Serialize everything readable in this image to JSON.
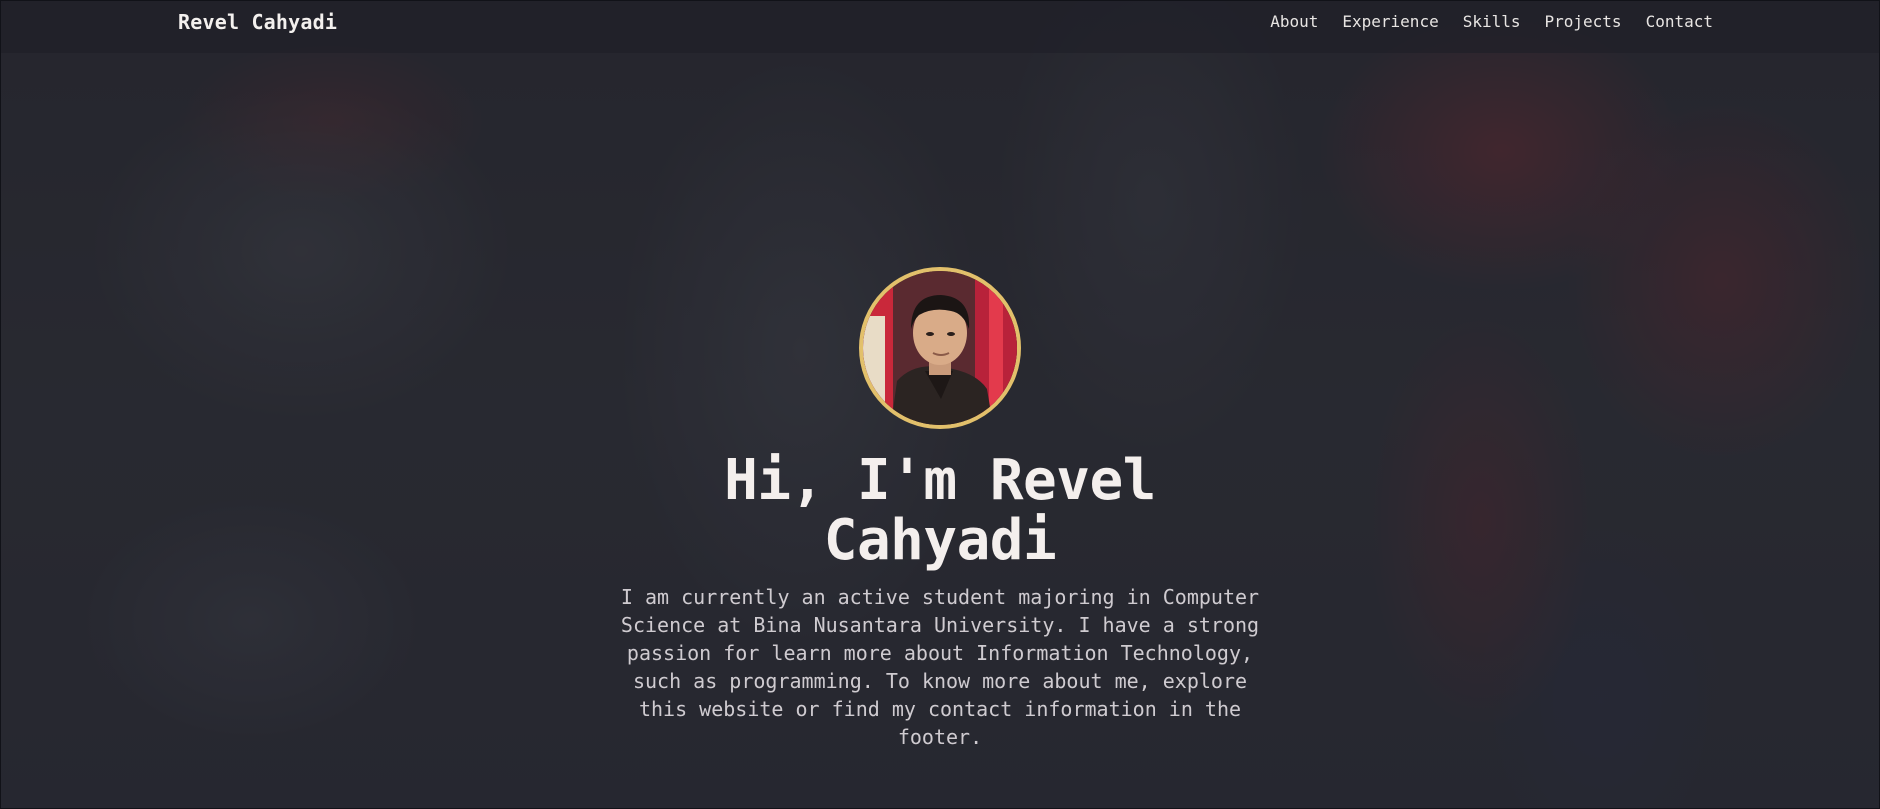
{
  "navbar": {
    "brand": "Revel Cahyadi",
    "links": [
      {
        "label": "About"
      },
      {
        "label": "Experience"
      },
      {
        "label": "Skills"
      },
      {
        "label": "Projects"
      },
      {
        "label": "Contact"
      }
    ]
  },
  "hero": {
    "avatar_alt": "profile photo",
    "title": "Hi, I'm Revel Cahyadi",
    "description": "I am currently an active student majoring in Computer Science at Bina Nusantara University. I have a strong passion for learn more about Information Technology, such as programming. To know more about me, explore this website or find my contact information in the footer."
  },
  "colors": {
    "accent_border": "#e2c06b",
    "text_primary": "#f4efed",
    "text_secondary": "#cfcbd0",
    "navbar_bg": "#20202a"
  }
}
